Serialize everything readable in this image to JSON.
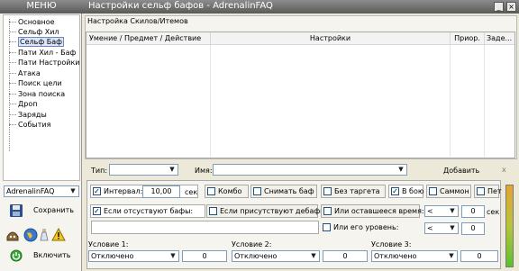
{
  "menu": {
    "title": "МЕНЮ",
    "items": [
      "Основное",
      "Сельф Хил",
      "Сельф Баф",
      "Пати Хил - Баф",
      "Пати Настройки",
      "Атака",
      "Поиск цели",
      "Зона поиска",
      "Дроп",
      "Заряды",
      "События"
    ],
    "selected": "Сельф Баф",
    "profile": "AdrenalinFAQ",
    "save_label": "Сохранить",
    "enable_label": "Включить"
  },
  "window": {
    "title": "Настройки сельф бафов  -  AdrenalinFAQ"
  },
  "skills": {
    "group_title": "Настройка Скилов/Итемов",
    "columns": [
      "Умение / Предмет / Действие",
      "Настройки",
      "Приор.",
      "Заде..."
    ]
  },
  "filter": {
    "type_label": "Тип:",
    "type_value": "",
    "name_label": "Имя:",
    "name_value": "",
    "add_label": "Добавить",
    "clear_label": "x"
  },
  "options": {
    "interval_label": "Интервал:",
    "interval_value": "10,00",
    "interval_unit": "сек",
    "combo_label": "Комбо",
    "remove_buff_label": "Снимать баф",
    "no_target_label": "Без таргета",
    "in_combat_label": "В бою",
    "summon_label": "Саммон",
    "pet_label": "Пет",
    "missing_buffs_label": "Если отсуствуют бафы:",
    "present_debuffs_label": "Если присутствуют дебафы:",
    "time_left_label": "Или оставшееся время:",
    "time_left_op": "<",
    "time_left_value": "0",
    "time_left_unit": "сек",
    "level_label": "Или его уровень:",
    "level_op": "<",
    "level_value": "0"
  },
  "conditions": [
    {
      "label": "Условие 1:",
      "value": "Отключено",
      "number": "0"
    },
    {
      "label": "Условие 2:",
      "value": "Отключено",
      "number": "0"
    },
    {
      "label": "Условие 3:",
      "value": "Отключено",
      "number": "0"
    }
  ],
  "colors": {
    "header_bg": "#6f6f6f",
    "panel_bg": "#ece9d8",
    "selected_item": "#dde6f8",
    "level_bar_top": "#e6a233",
    "level_bar_bottom": "#5cc02e"
  }
}
